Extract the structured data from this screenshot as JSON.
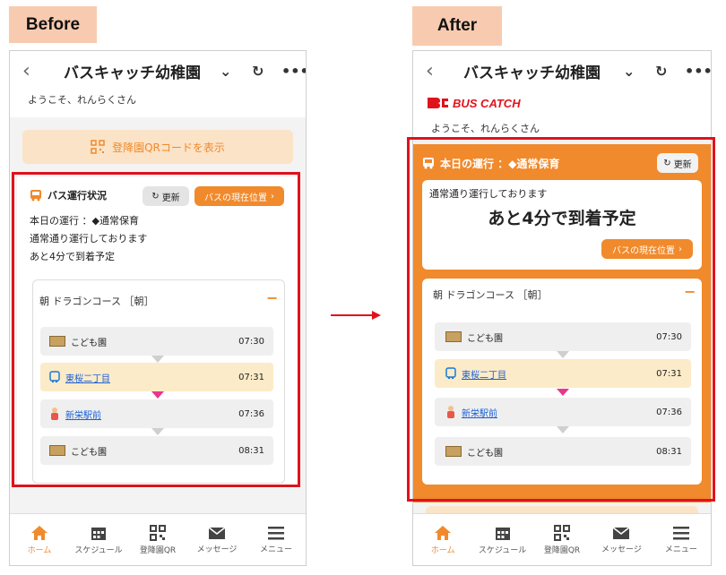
{
  "labels": {
    "before": "Before",
    "after": "After"
  },
  "header": {
    "back": "‹",
    "title": "バスキャッチ幼稚園"
  },
  "welcome": "ようこそ、れんらくさん",
  "logo_text": "BUS CATCH",
  "qr_button": "登降園QRコードを表示",
  "before_panel": {
    "title": "バス運行状況",
    "refresh": "更新",
    "location": "バスの現在位置",
    "line1": "本日の運行 ：◆通常保育",
    "line2": "通常通り運行しております",
    "line3": "あと4分で到着予定"
  },
  "after_panel": {
    "title": "本日の運行 ：◆通常保育",
    "refresh": "更新",
    "status": "通常通り運行しております",
    "eta": "あと4分で到着予定",
    "location": "バスの現在位置"
  },
  "course": {
    "title": "朝 ドラゴンコース ［朝］",
    "toggle": "−"
  },
  "stops": [
    {
      "name": "こども園",
      "time": "07:30",
      "type": "school"
    },
    {
      "name": "東桜二丁目",
      "time": "07:31",
      "type": "bus"
    },
    {
      "name": "新栄駅前",
      "time": "07:36",
      "type": "person"
    },
    {
      "name": "こども園",
      "time": "08:31",
      "type": "school"
    }
  ],
  "tabs": [
    {
      "label": "ホーム",
      "icon": "home-icon"
    },
    {
      "label": "スケジュール",
      "icon": "calendar-icon"
    },
    {
      "label": "登降園QR",
      "icon": "qr-icon"
    },
    {
      "label": "メッセージ",
      "icon": "mail-icon"
    },
    {
      "label": "メニュー",
      "icon": "menu-icon"
    }
  ],
  "colors": {
    "accent": "#f08a2c",
    "highlight": "#e0121b",
    "current_stop": "#fcebc8"
  }
}
